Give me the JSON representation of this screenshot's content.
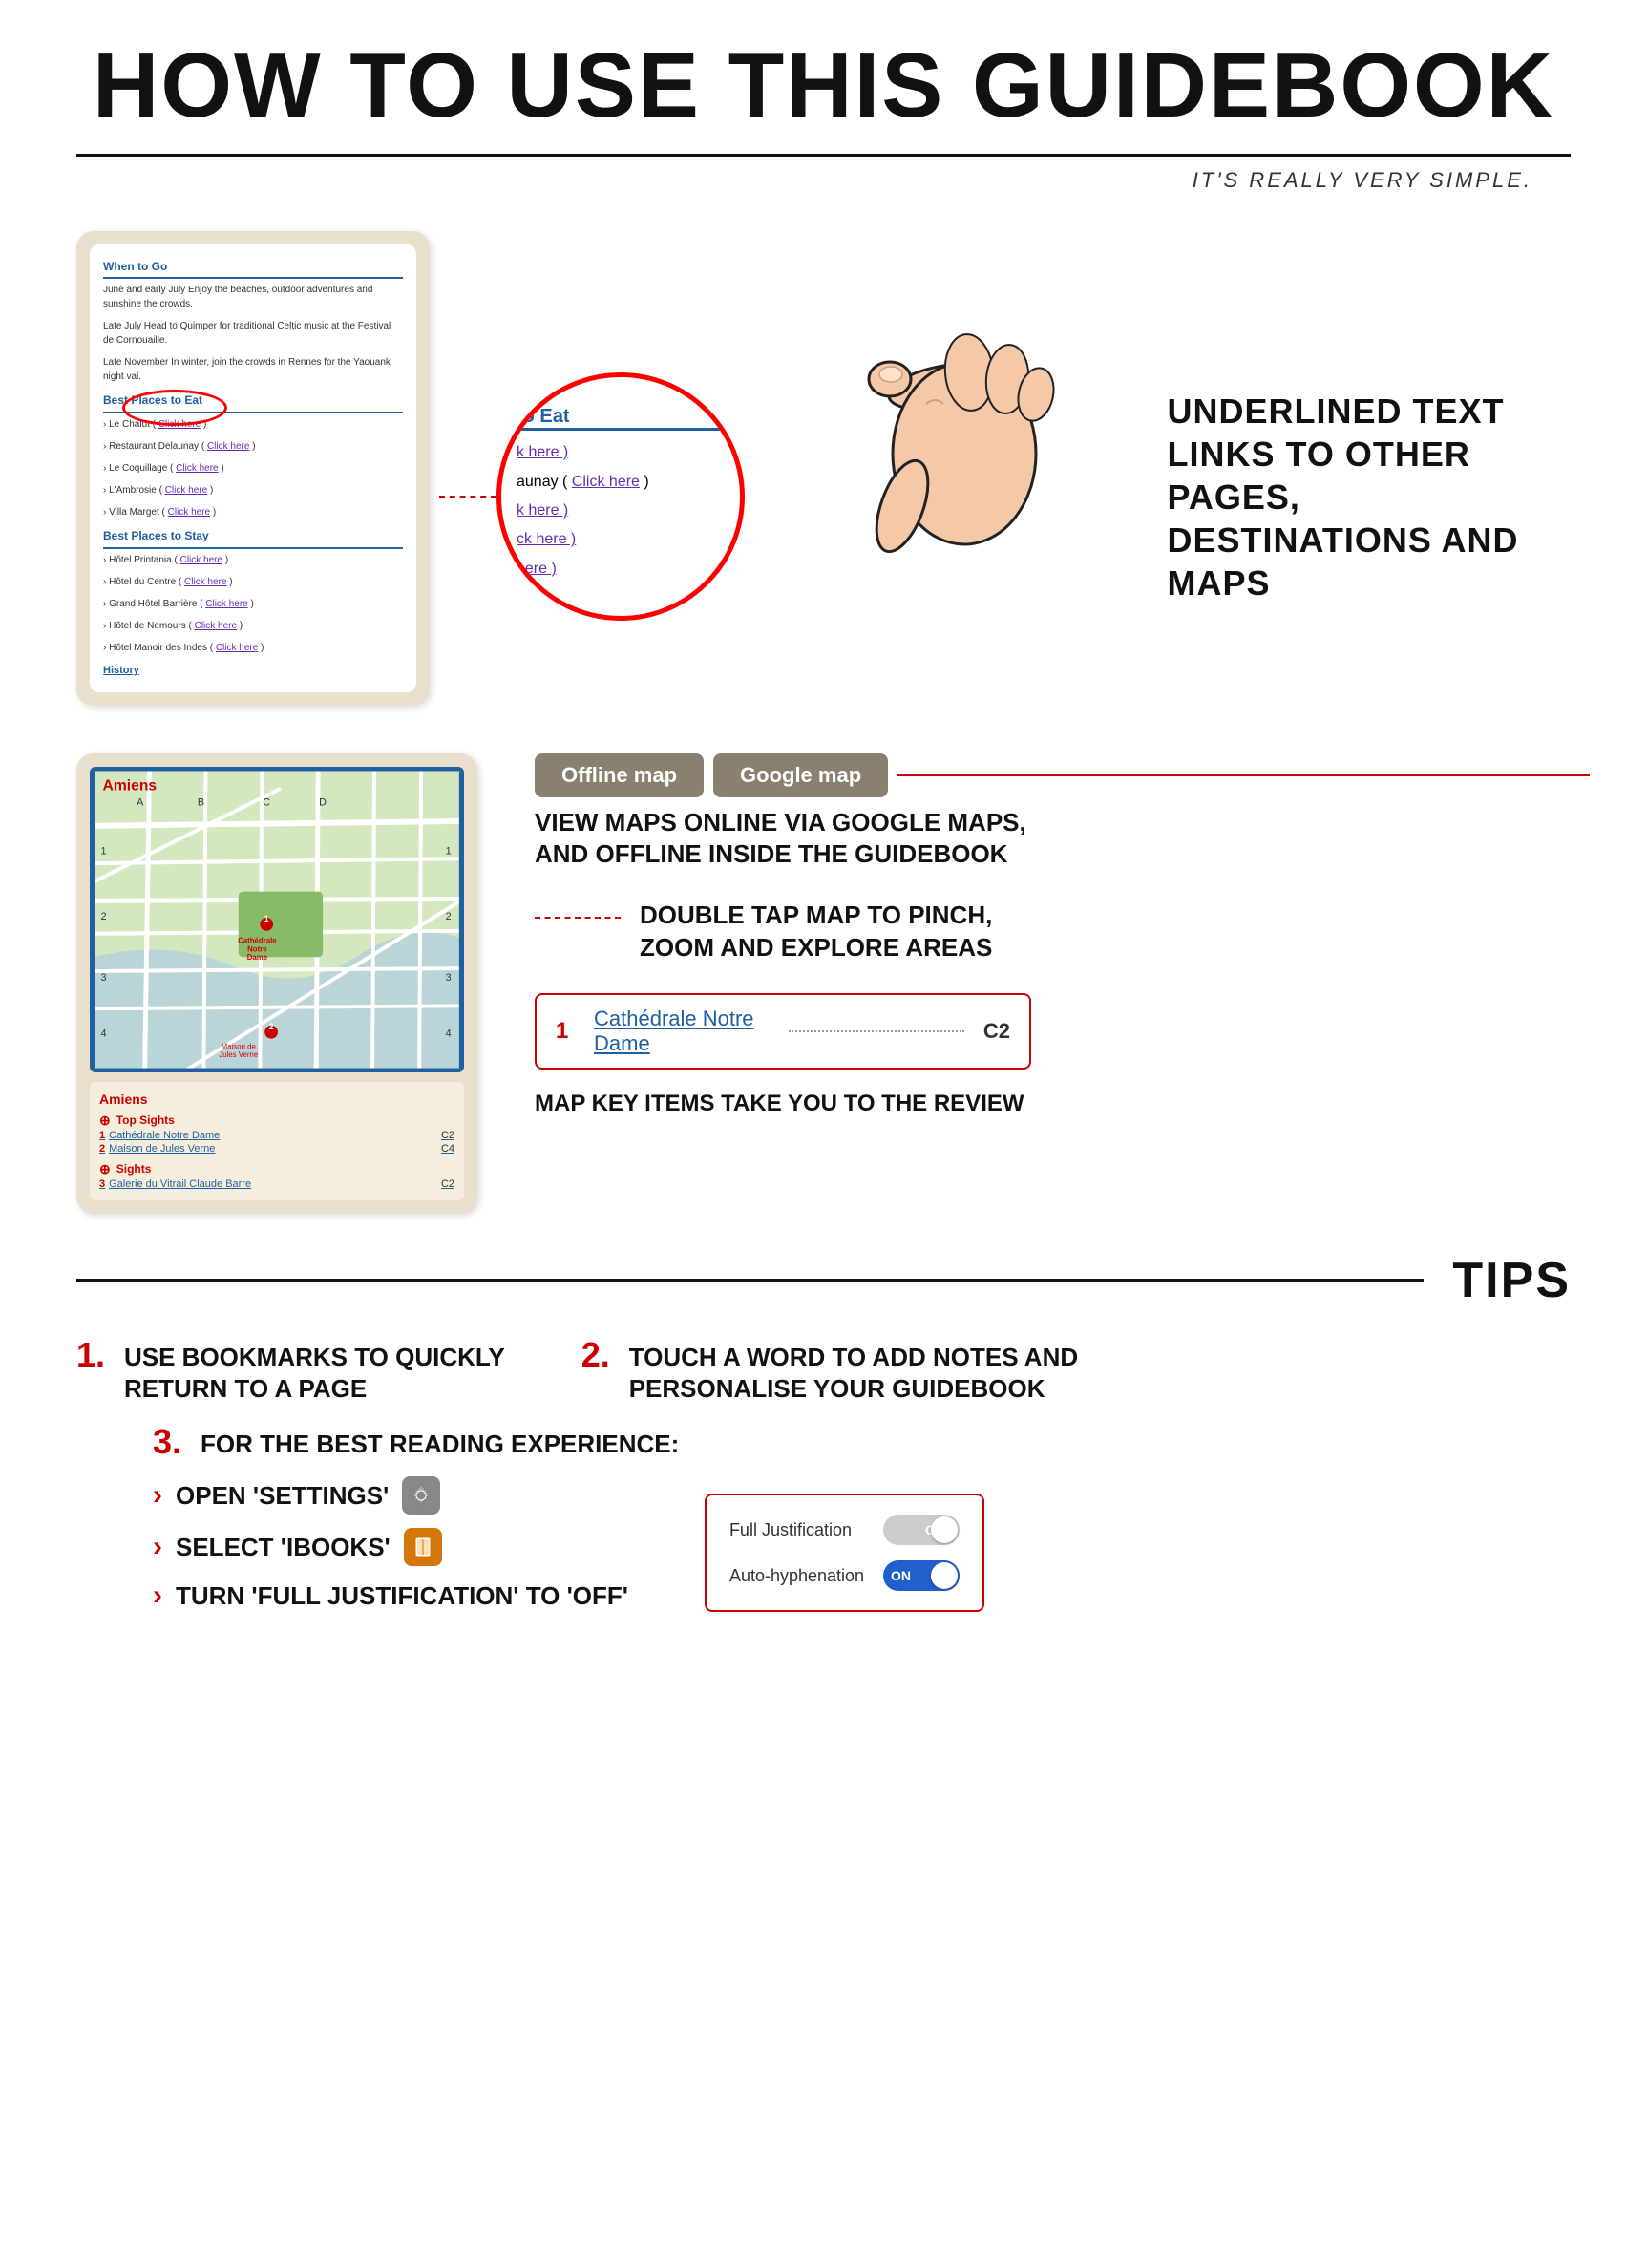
{
  "header": {
    "title": "HOW TO USE THIS GUIDEBOOK",
    "subtitle": "IT'S REALLY VERY SIMPLE."
  },
  "section1": {
    "links_label": "UNDERLINED TEXT\nLINKS TO OTHER PAGES,\nDESTINATIONS AND MAPS",
    "mockup": {
      "when_to_go_title": "When to Go",
      "when_to_go_text1": "June and early July Enjoy the beaches, outdoor adventures and sunshine the crowds.",
      "when_to_go_text2": "Late July Head to Quimper for traditional Celtic music at the Festival de Cornouaille.",
      "when_to_go_text3": "Late November In winter, join the crowds in Rennes for the Yaouank night val.",
      "places_to_eat_title": "Best Places to Eat",
      "places_eat_items": [
        "Le Chalut ( Click here )",
        "Restaurant Delaunay ( Click here )",
        "Le Coquillage ( Click here )",
        "L'Ambrosie ( Click here )",
        "Villa Marget ( Click here )"
      ],
      "places_stay_title": "Best Places to Stay",
      "places_stay_items": [
        "Hôtel Printania ( Click here )",
        "Hôtel du Centre ( Click here )",
        "Grand Hôtel Barrière ( Click here )",
        "Hôtel de Nemours ( Click here )",
        "Hôtel Manoir des Indes ( Click here )"
      ],
      "history_link": "History"
    },
    "zoomed": {
      "title": "to Eat",
      "items": [
        "k here )",
        "aunay ( Click here )",
        "k here )",
        "ck here )",
        "here )"
      ]
    }
  },
  "section2": {
    "btn_offline": "Offline map",
    "btn_google": "Google map",
    "map_desc1": "VIEW MAPS ONLINE VIA GOOGLE MAPS,\nAND OFFLINE INSIDE THE GUIDEBOOK",
    "map_desc2": "DOUBLE TAP MAP TO PINCH,\nZOOM AND EXPLORE AREAS",
    "map_key_num": "1",
    "map_key_name": "Cathédrale Notre Dame",
    "map_key_coord": "C2",
    "map_key_desc": "MAP KEY ITEMS TAKE YOU TO THE REVIEW",
    "mockup": {
      "city": "Amiens",
      "legend_city": "Amiens",
      "top_sights_label": "Top Sights",
      "top_sights": [
        {
          "num": "1",
          "name": "Cathédrale Notre Dame",
          "coord": "C2"
        },
        {
          "num": "2",
          "name": "Maison de Jules Verne",
          "coord": "C4"
        }
      ],
      "sights_label": "Sights",
      "sights": [
        {
          "num": "3",
          "name": "Galerie du Vitrail Claude Barre",
          "coord": "C2"
        }
      ]
    }
  },
  "tips": {
    "label": "TIPS",
    "tip1_num": "1.",
    "tip1_text": "USE BOOKMARKS TO QUICKLY\nRETURN TO A PAGE",
    "tip2_num": "2.",
    "tip2_text": "TOUCH A WORD TO ADD NOTES AND\nPERSONALISE YOUR GUIDEBOOK",
    "tip3_num": "3.",
    "tip3_text": "FOR THE BEST READING EXPERIENCE:",
    "tip3_items": [
      {
        "text": "Open 'Settings'",
        "icon": "settings"
      },
      {
        "text": "Select 'iBooks'",
        "icon": "ibooks"
      },
      {
        "text": "Turn 'Full Justification' to 'off'",
        "icon": ""
      }
    ],
    "toggles": [
      {
        "label": "Full Justification",
        "state": "OFF",
        "on": false
      },
      {
        "label": "Auto-hyphenation",
        "state": "ON",
        "on": true
      }
    ]
  }
}
